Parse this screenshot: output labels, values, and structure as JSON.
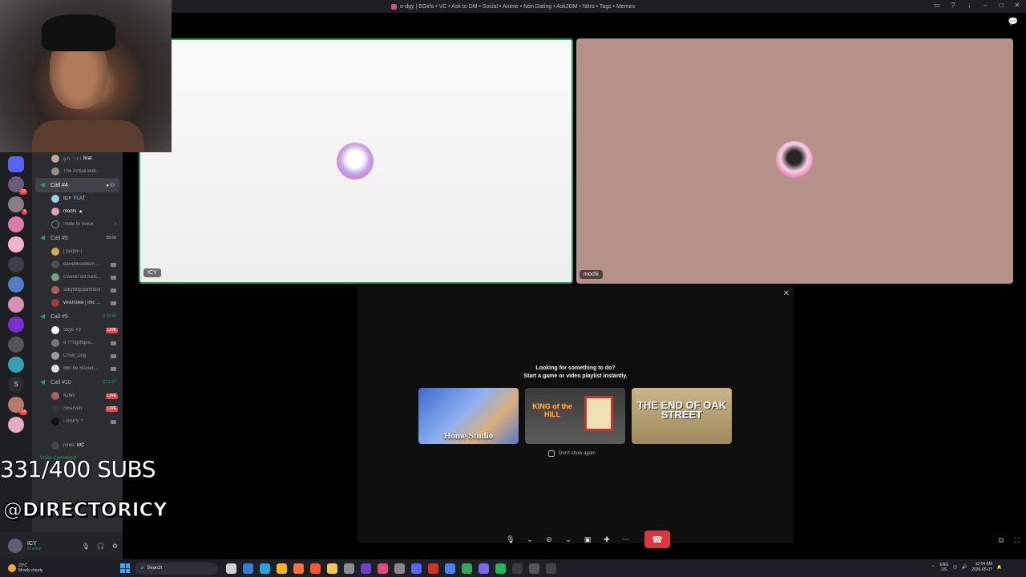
{
  "window": {
    "title": "e-dgy | EGirls • VC • Ask to DM • Social • Anime • Non Dating • Ask2DM • Nitro • Tags • Memes"
  },
  "sidebar": {
    "top_users": [
      {
        "name": "g h ♡ t !",
        "tag": "brat"
      },
      {
        "name": "The Actual Bub..."
      }
    ],
    "channels": [
      {
        "label": "Call #4",
        "active": true,
        "timer": "",
        "users": [
          {
            "name": "ICY",
            "tag": "FLAT"
          },
          {
            "name": "mochi"
          },
          {
            "name": "Invite to Voice"
          }
        ]
      },
      {
        "label": "Call #5",
        "active": false,
        "timer": "05 06",
        "users": [
          {
            "name": "| purple |"
          },
          {
            "name": "davidlikesblum..."
          },
          {
            "name": "Goonin wit Ketc..."
          },
          {
            "name": "silkykittyuwithfent"
          },
          {
            "name": "vinsmoke | mic ..."
          }
        ]
      },
      {
        "label": "Call #9",
        "active": false,
        "timer": "2:29:56",
        "users": [
          {
            "name": "Skye <3",
            "live": "LIVE"
          },
          {
            "name": "ɞ·ꔫ𝔖gi𝔅quis..."
          },
          {
            "name": "Crow_Dog"
          },
          {
            "name": "𝔊𝔈The Stoner..."
          }
        ]
      },
      {
        "label": "Call #10",
        "active": false,
        "timer": "2:21:07",
        "users": [
          {
            "name": "426lll",
            "live": "LIVE"
          },
          {
            "name": "Swerven",
            "live": "LIVE"
          },
          {
            "name": "! DAPS ?"
          },
          {
            "name": "pinks",
            "tag": "MC"
          }
        ]
      }
    ],
    "voice_status": "Voice Connected"
  },
  "user_panel": {
    "name": "ICY",
    "status": "In voice"
  },
  "call": {
    "tiles": [
      {
        "name": "ICY"
      },
      {
        "name": "mochi"
      }
    ]
  },
  "activity": {
    "heading": "Looking for something to do?",
    "subheading": "Start a game or video playlist instantly.",
    "cards": [
      {
        "label": "Home Studio"
      },
      {
        "label": "KING of the HILL"
      },
      {
        "label": "THE END OF OAK STREET"
      }
    ],
    "dont_show_label": "Don't show again"
  },
  "overlay": {
    "subs": "331/400 SUBS",
    "handle": "@DIRECTORICY"
  },
  "taskbar": {
    "temperature": "23°C",
    "weather": "Mostly cloudy",
    "search_placeholder": "Search",
    "lang": "ENG",
    "region": "US",
    "time": "12:04 AM",
    "date": "2026-05-07"
  },
  "colors": {
    "speaking_border": "#23a55a",
    "hangup": "#da373c",
    "live_badge": "#f23f43",
    "sidebar_bg": "#2b2d31"
  }
}
